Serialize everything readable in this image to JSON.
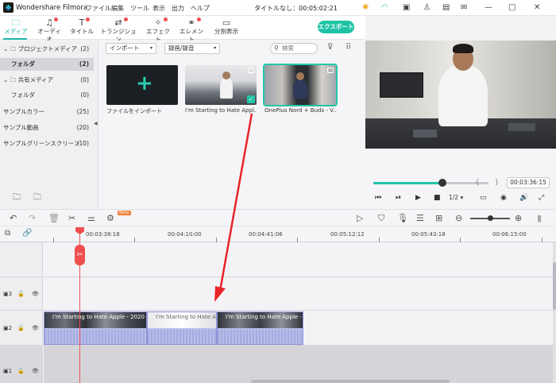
{
  "app": {
    "name": "Wondershare Filmora",
    "menus": [
      "ファイル",
      "編集",
      "ツール",
      "表示",
      "出力",
      "ヘルプ"
    ],
    "title": "タイトルなし：00:05:02:21"
  },
  "tabs": [
    {
      "label": "メディア",
      "icon": "folder-icon",
      "active": true,
      "dot": false
    },
    {
      "label": "オーディオ",
      "icon": "music-note-icon",
      "active": false,
      "dot": true
    },
    {
      "label": "タイトル",
      "icon": "text-icon",
      "active": false,
      "dot": true
    },
    {
      "label": "トランジション",
      "icon": "transition-icon",
      "active": false,
      "dot": true
    },
    {
      "label": "エフェクト",
      "icon": "effects-icon",
      "active": false,
      "dot": true
    },
    {
      "label": "エレメント",
      "icon": "elements-icon",
      "active": false,
      "dot": true
    },
    {
      "label": "分割表示",
      "icon": "split-screen-icon",
      "active": false,
      "dot": false
    }
  ],
  "export_label": "エクスポート",
  "sidebar": {
    "items": [
      {
        "label": "プロジェクトメディア",
        "count": "(2)",
        "folder": true,
        "selected": false
      },
      {
        "label": "フォルダ",
        "count": "(2)",
        "folder": false,
        "selected": true
      },
      {
        "label": "共有メディア",
        "count": "(0)",
        "folder": true,
        "selected": false
      },
      {
        "label": "フォルダ",
        "count": "(0)",
        "folder": false,
        "selected": false
      },
      {
        "label": "サンプルカラー",
        "count": "(25)",
        "folder": false,
        "selected": false
      },
      {
        "label": "サンプル動画",
        "count": "(20)",
        "folder": false,
        "selected": false
      },
      {
        "label": "サンプルグリーンスクリーン",
        "count": "(10)",
        "folder": false,
        "selected": false
      }
    ]
  },
  "media": {
    "import_dropdown": "インポート",
    "record_dropdown": "録画/録音",
    "search_placeholder": "検索",
    "cards": [
      {
        "caption": "ファイルをインポート"
      },
      {
        "caption": "I'm Starting to Hate Appl..."
      },
      {
        "caption": "OnePlus Nord + Buds - V..."
      }
    ]
  },
  "preview": {
    "timecode": "00:03:36:15",
    "ratio": "1/2",
    "progress": 0.6
  },
  "timeline": {
    "ruler_labels": [
      "00:03:38:18",
      "00:04:10:00",
      "00:04:41:06",
      "00:05:12:12",
      "00:05:43:18",
      "00:06:15:00"
    ],
    "beta_label": "Beta",
    "clips": [
      {
        "name": "I'm Starting to Hate Apple - 2020 Ma"
      },
      {
        "name": "I'm Starting to Hate Apple - 2020 Ma"
      },
      {
        "name": "I'm Starting to Hate Apple - 2020 Ma"
      }
    ],
    "track_numbers": [
      "",
      "3",
      "2",
      "1"
    ]
  },
  "colors": {
    "accent": "#1fc3a6",
    "playhead": "#f04f4f",
    "clip": "#b9bde8"
  }
}
